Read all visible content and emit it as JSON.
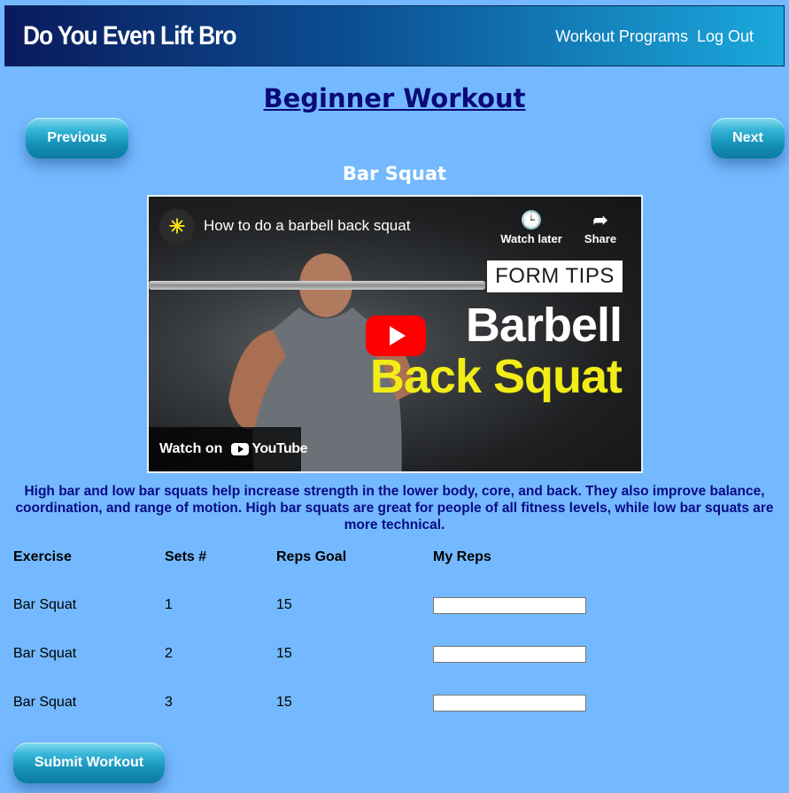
{
  "navbar": {
    "brand": "Do You Even Lift Bro",
    "links": [
      "Workout Programs",
      "Log Out"
    ]
  },
  "page": {
    "title": "Beginner Workout",
    "previous_label": "Previous",
    "next_label": "Next"
  },
  "exercise": {
    "name": "Bar Squat",
    "video": {
      "title": "How to do a barbell back squat",
      "watch_later": "Watch later",
      "share": "Share",
      "thumb_tag": "FORM TIPS",
      "thumb_line1": "Barbell",
      "thumb_line2": "Back Squat",
      "watch_on": "Watch on",
      "platform": "YouTube"
    },
    "description": "High bar and low bar squats help increase strength in the lower body, core, and back. They also improve balance, coordination, and range of motion. High bar squats are great for people of all fitness levels, while low bar squats are more technical."
  },
  "table": {
    "headers": [
      "Exercise",
      "Sets #",
      "Reps Goal",
      "My Reps"
    ],
    "rows": [
      {
        "exercise": "Bar Squat",
        "set": "1",
        "reps_goal": "15",
        "my_reps": ""
      },
      {
        "exercise": "Bar Squat",
        "set": "2",
        "reps_goal": "15",
        "my_reps": ""
      },
      {
        "exercise": "Bar Squat",
        "set": "3",
        "reps_goal": "15",
        "my_reps": ""
      }
    ]
  },
  "submit_label": "Submit Workout",
  "colors": {
    "background": "#74b9ff",
    "title": "#0a0a78",
    "description": "#0a0a86",
    "button": "#1591b8"
  }
}
